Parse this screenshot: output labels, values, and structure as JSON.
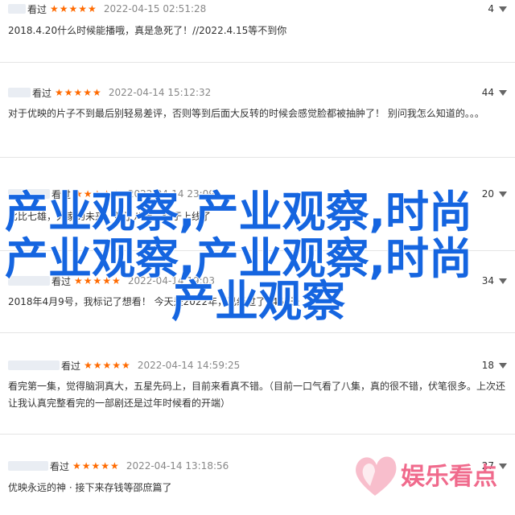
{
  "reviews": [
    {
      "status": "看过",
      "stars": "★★★★★",
      "time": "2022-04-15 02:51:28",
      "votes": "4",
      "text": "2018.4.20什么时候能播哦，真是急死了！//2022.4.15等不到你"
    },
    {
      "status": "看过",
      "stars": "★★★★★",
      "time": "2022-04-14 15:12:32",
      "votes": "44",
      "text": "对于优映的片子不到最后别轻易差评，否则等到后面大反转的时候会感觉脸都被抽肿了！ 别问我怎么知道的。。。"
    },
    {
      "status": "看过",
      "stars": "★★★★★",
      "time": "2022-04-14 23:09",
      "votes": "20",
      "text": "比比七雄，大家的未来，等了八年，终于上线了"
    },
    {
      "status": "看过",
      "stars": "★★★★★",
      "time": "2022-04-14 19:03",
      "votes": "34",
      "text": "2018年4月9号，我标记了想看！ 今天是2022年，已经过了1466天"
    },
    {
      "status": "看过",
      "stars": "★★★★★",
      "time": "2022-04-14 14:59:25",
      "votes": "18",
      "text": "看完第一集，觉得脑洞真大，五星先码上，目前来看真不错。（目前一口气看了八集，真的很不错，伏笔很多。上次还让我认真完整看完的一部剧还是过年时候看的开端）"
    },
    {
      "status": "看过",
      "stars": "★★★★★",
      "time": "2022-04-14 13:18:56",
      "votes": "27",
      "text": "优映永远的神 · 接下来存钱等邵庶篇了"
    }
  ],
  "watermark": {
    "overlay_line1": "产业观察,产业观察,时尚",
    "overlay_line2": "产业观察,产业观察,时尚",
    "overlay_line3": "产业观察",
    "logo_text": "娱乐看点",
    "overlay_color": "#1565e0",
    "logo_color": "#f06a8c"
  },
  "colors": {
    "stars": "#ff6a00",
    "text": "#333333",
    "time": "#888888",
    "divider": "#e5e5e5"
  }
}
